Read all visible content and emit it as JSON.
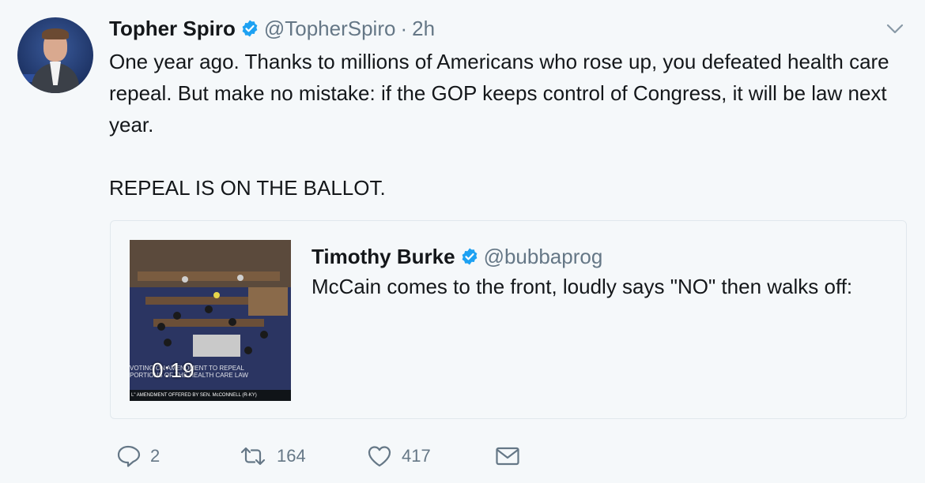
{
  "tweet": {
    "author_name": "Topher Spiro",
    "author_handle": "@TopherSpiro",
    "separator": "·",
    "time": "2h",
    "text": "One year ago. Thanks to millions of Americans who rose up, you defeated health care repeal. But make no mistake: if the GOP keeps control of Congress, it will be law next year.\n\nREPEAL IS ON THE BALLOT.",
    "avatar_icon": "avatar-photo",
    "verified_icon": "verified-badge-icon",
    "menu_icon": "chevron-down-icon"
  },
  "quoted": {
    "author_name": "Timothy Burke",
    "author_handle": "@bubbaprog",
    "text": "McCain comes to the front, loudly says \"NO\" then walks off:",
    "video": {
      "duration": "0:19",
      "caption_line1": "VOTING ON AMENDMENT TO REPEAL",
      "caption_line2": "PORTIONS OF THE HEALTH CARE LAW",
      "caption_bar": "L\" AMENDMENT OFFERED BY SEN. McCONNELL (R-KY)"
    }
  },
  "actions": {
    "reply_count": "2",
    "retweet_count": "164",
    "like_count": "417"
  },
  "colors": {
    "background": "#f5f8fa",
    "verified": "#1da1f2",
    "secondary_text": "#657786",
    "border": "#e1e8ed"
  }
}
